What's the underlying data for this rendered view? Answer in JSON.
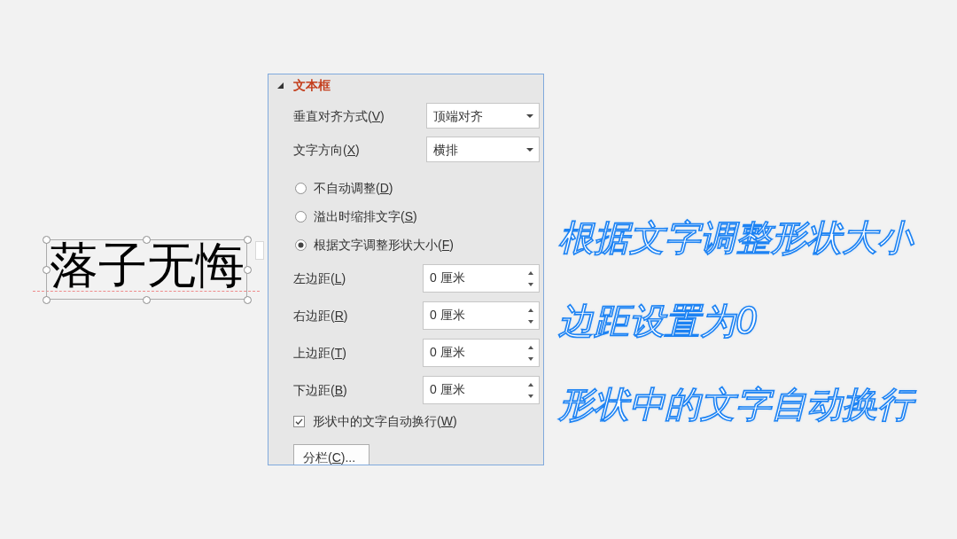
{
  "text_box": {
    "text": "落子无悔",
    "selected": true
  },
  "format_pane": {
    "section": {
      "title": "文本框",
      "expanded": true
    },
    "dropdowns": [
      {
        "label": "垂直对齐方式(V)",
        "value": "顶端对齐"
      },
      {
        "label": "文字方向(X)",
        "value": "横排"
      }
    ],
    "autofit_options": [
      {
        "label": "不自动调整(D)",
        "selected": false
      },
      {
        "label": "溢出时缩排文字(S)",
        "selected": false
      },
      {
        "label": "根据文字调整形状大小(F)",
        "selected": true
      }
    ],
    "margins": [
      {
        "label": "左边距(L)",
        "value": "0 厘米"
      },
      {
        "label": "右边距(R)",
        "value": "0 厘米"
      },
      {
        "label": "上边距(T)",
        "value": "0 厘米"
      },
      {
        "label": "下边距(B)",
        "value": "0 厘米"
      }
    ],
    "wrap_text": {
      "label": "形状中的文字自动换行(W)",
      "checked": true
    },
    "columns_button": "分栏(C)..."
  },
  "captions": [
    "根据文字调整形状大小",
    "边距设置为0",
    "形状中的文字自动换行"
  ]
}
